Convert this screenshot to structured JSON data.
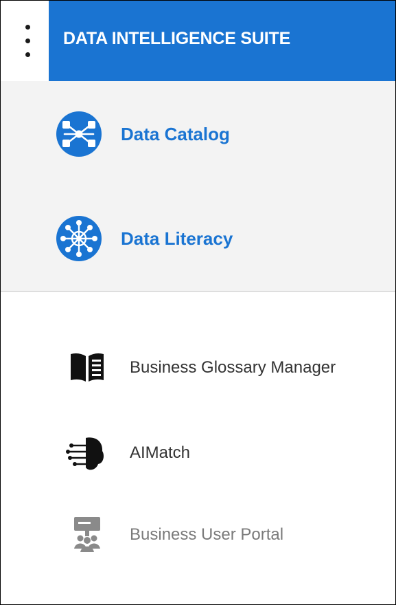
{
  "header": {
    "title": "DATA INTELLIGENCE SUITE",
    "menu_icon": "kebab-vertical-icon",
    "background_color": "#1a74d2"
  },
  "products": [
    {
      "label": "Data Catalog",
      "icon": "data-catalog-icon",
      "color": "#1a74d2"
    },
    {
      "label": "Data Literacy",
      "icon": "data-literacy-icon",
      "color": "#1a74d2"
    }
  ],
  "tools": [
    {
      "label": "Business Glossary Manager",
      "icon": "open-book-icon"
    },
    {
      "label": "AIMatch",
      "icon": "ai-brain-icon"
    },
    {
      "label": "Business User Portal",
      "icon": "business-user-portal-icon",
      "muted": true
    }
  ],
  "colors": {
    "top_section_background": "#f3f3f3",
    "product_text": "#1a74d2",
    "tool_text": "#333333",
    "muted_tool_text": "#7a7a7a"
  }
}
